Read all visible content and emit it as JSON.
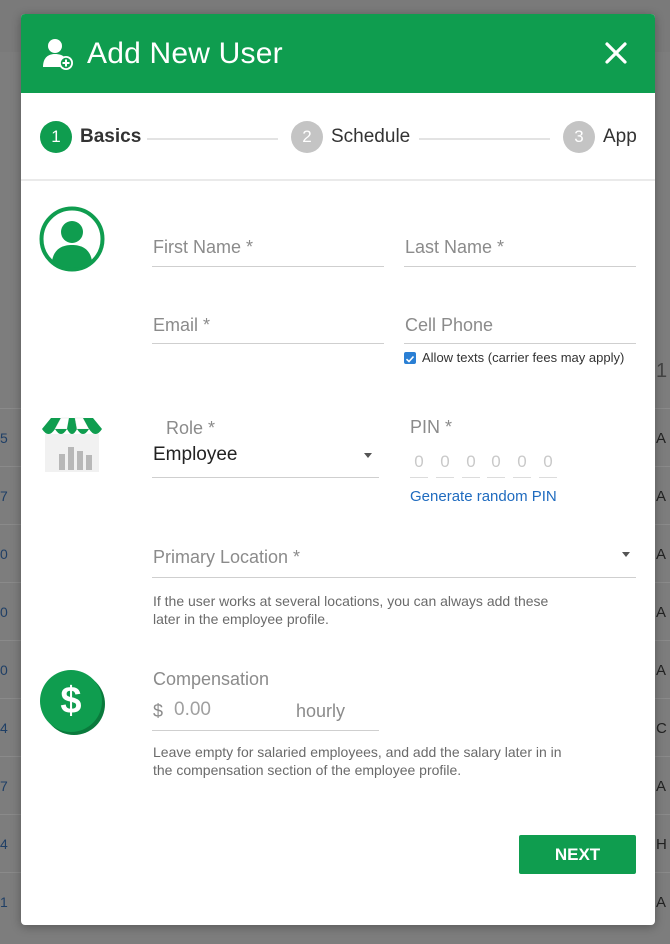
{
  "modal": {
    "title": "Add New User",
    "close_icon": "close-icon",
    "header_icon": "add-user-icon",
    "accent": "#0f9d4f"
  },
  "stepper": {
    "steps": [
      {
        "number": "1",
        "label": "Basics",
        "state": "active"
      },
      {
        "number": "2",
        "label": "Schedule",
        "state": "inactive"
      },
      {
        "number": "3",
        "label": "App",
        "state": "inactive"
      }
    ]
  },
  "form": {
    "first_name": {
      "label": "First Name *",
      "value": ""
    },
    "last_name": {
      "label": "Last Name *",
      "value": ""
    },
    "email": {
      "label": "Email *",
      "value": ""
    },
    "cell_phone": {
      "label": "Cell Phone",
      "value": ""
    },
    "allow_texts": {
      "label": "Allow texts (carrier fees may apply)",
      "checked": true
    },
    "role": {
      "label": "Role *",
      "value": "Employee"
    },
    "pin": {
      "label": "PIN *",
      "digits": [
        "0",
        "0",
        "0",
        "0",
        "0",
        "0"
      ],
      "generate_label": "Generate random PIN"
    },
    "primary_location": {
      "label": "Primary Location *",
      "help": "If the user works at several locations, you can always add these later in the employee profile."
    },
    "compensation": {
      "label": "Compensation",
      "currency": "$",
      "placeholder": "0.00",
      "unit": "hourly",
      "help": "Leave empty for salaried employees, and add the salary later in in the compensation section of the employee profile."
    }
  },
  "icons": {
    "avatar": "user-avatar-icon",
    "store": "store-icon",
    "dollar": "dollar-icon"
  },
  "actions": {
    "next_label": "NEXT"
  },
  "background": {
    "left_chars": [
      "5",
      "7",
      "0",
      "0",
      "0",
      "4",
      "7",
      "4",
      "1"
    ],
    "right_chars": [
      "A",
      "A",
      "A",
      "A",
      "A",
      "C",
      "A",
      "H",
      "A"
    ],
    "right_extra": "1"
  }
}
